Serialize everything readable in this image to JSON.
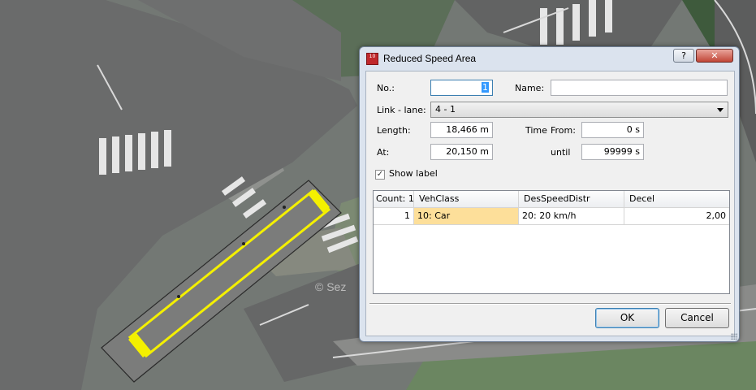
{
  "map": {
    "watermark": "© Sez"
  },
  "dialog": {
    "title": "Reduced Speed Area",
    "app_icon_text": "10",
    "help_label": "?",
    "close_label": "✕",
    "fields": {
      "no_label": "No.:",
      "no_value": "1",
      "name_label": "Name:",
      "name_value": "",
      "link_lane_label": "Link - lane:",
      "link_lane_value": "4 - 1",
      "length_label": "Length:",
      "length_value": "18,466 m",
      "at_label": "At:",
      "at_value": "20,150 m",
      "time_label": "Time",
      "from_label": "From:",
      "from_value": "0 s",
      "until_label": "until",
      "until_value": "99999 s",
      "show_label_text": "Show label",
      "show_label_checked": true,
      "checkbox_glyph": "✓"
    },
    "table": {
      "headers": [
        "Count: 1",
        "VehClass",
        "DesSpeedDistr",
        "Decel"
      ],
      "rows": [
        [
          "1",
          "10: Car",
          "20: 20 km/h",
          "2,00"
        ]
      ]
    },
    "buttons": {
      "ok": "OK",
      "cancel": "Cancel"
    }
  }
}
